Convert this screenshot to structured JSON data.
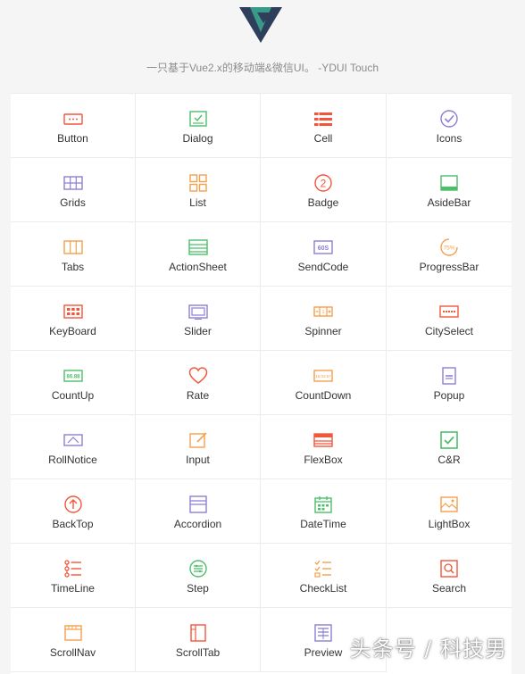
{
  "header": {
    "subtitle": "一只基于Vue2.x的移动端&微信UI。 -YDUI Touch"
  },
  "colors": {
    "red": "#f2563a",
    "orange": "#f5a04c",
    "green": "#4cbf6a",
    "purple": "#8a7fd6",
    "teal": "#3a8a7e",
    "navy": "#2e3f5c"
  },
  "components": [
    {
      "label": "Button",
      "icon": "button-icon",
      "color": "#f2563a"
    },
    {
      "label": "Dialog",
      "icon": "dialog-icon",
      "color": "#4cbf6a"
    },
    {
      "label": "Cell",
      "icon": "cell-icon",
      "color": "#f2563a"
    },
    {
      "label": "Icons",
      "icon": "icons-icon",
      "color": "#8a7fd6"
    },
    {
      "label": "Grids",
      "icon": "grids-icon",
      "color": "#8a7fd6"
    },
    {
      "label": "List",
      "icon": "list-icon",
      "color": "#f5a04c"
    },
    {
      "label": "Badge",
      "icon": "badge-icon",
      "color": "#f2563a"
    },
    {
      "label": "AsideBar",
      "icon": "asidebar-icon",
      "color": "#4cbf6a"
    },
    {
      "label": "Tabs",
      "icon": "tabs-icon",
      "color": "#f5a04c"
    },
    {
      "label": "ActionSheet",
      "icon": "actionsheet-icon",
      "color": "#4cbf6a"
    },
    {
      "label": "SendCode",
      "icon": "sendcode-icon",
      "color": "#8a7fd6"
    },
    {
      "label": "ProgressBar",
      "icon": "progressbar-icon",
      "color": "#f5a04c"
    },
    {
      "label": "KeyBoard",
      "icon": "keyboard-icon",
      "color": "#f2563a"
    },
    {
      "label": "Slider",
      "icon": "slider-icon",
      "color": "#8a7fd6"
    },
    {
      "label": "Spinner",
      "icon": "spinner-icon",
      "color": "#f5a04c"
    },
    {
      "label": "CitySelect",
      "icon": "cityselect-icon",
      "color": "#f2563a"
    },
    {
      "label": "CountUp",
      "icon": "countup-icon",
      "color": "#4cbf6a"
    },
    {
      "label": "Rate",
      "icon": "rate-icon",
      "color": "#f2563a"
    },
    {
      "label": "CountDown",
      "icon": "countdown-icon",
      "color": "#f5a04c"
    },
    {
      "label": "Popup",
      "icon": "popup-icon",
      "color": "#8a7fd6"
    },
    {
      "label": "RollNotice",
      "icon": "rollnotice-icon",
      "color": "#8a7fd6"
    },
    {
      "label": "Input",
      "icon": "input-icon",
      "color": "#f5a04c"
    },
    {
      "label": "FlexBox",
      "icon": "flexbox-icon",
      "color": "#f2563a"
    },
    {
      "label": "C&R",
      "icon": "cr-icon",
      "color": "#4cbf6a"
    },
    {
      "label": "BackTop",
      "icon": "backtop-icon",
      "color": "#f2563a"
    },
    {
      "label": "Accordion",
      "icon": "accordion-icon",
      "color": "#8a7fd6"
    },
    {
      "label": "DateTime",
      "icon": "datetime-icon",
      "color": "#4cbf6a"
    },
    {
      "label": "LightBox",
      "icon": "lightbox-icon",
      "color": "#f5a04c"
    },
    {
      "label": "TimeLine",
      "icon": "timeline-icon",
      "color": "#f2563a"
    },
    {
      "label": "Step",
      "icon": "step-icon",
      "color": "#4cbf6a"
    },
    {
      "label": "CheckList",
      "icon": "checklist-icon",
      "color": "#f5a04c"
    },
    {
      "label": "Search",
      "icon": "search-icon",
      "color": "#f2563a"
    },
    {
      "label": "ScrollNav",
      "icon": "scrollnav-icon",
      "color": "#f5a04c"
    },
    {
      "label": "ScrollTab",
      "icon": "scrolltab-icon",
      "color": "#f2563a"
    },
    {
      "label": "Preview",
      "icon": "preview-icon",
      "color": "#8a7fd6"
    }
  ],
  "watermark": "头条号 / 科技男"
}
